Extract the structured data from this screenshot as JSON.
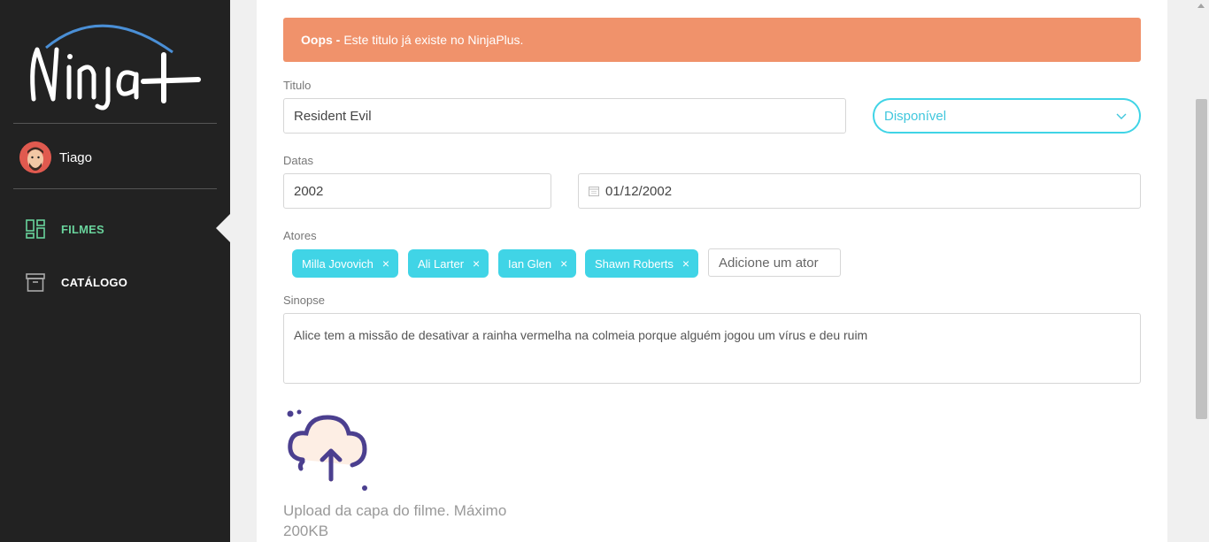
{
  "app": {
    "logo_text": "Ninja+"
  },
  "user": {
    "name": "Tiago"
  },
  "nav": {
    "items": [
      {
        "label": "FILMES",
        "icon": "dashboard-icon",
        "active": true
      },
      {
        "label": "CATÁLOGO",
        "icon": "archive-box-icon",
        "active": false
      }
    ]
  },
  "alert": {
    "strong": "Oops -",
    "message": "Este titulo já existe no NinjaPlus.",
    "color": "#f0926b"
  },
  "form": {
    "title_label": "Titulo",
    "title_value": "Resident Evil",
    "status_value": "Disponível",
    "dates_label": "Datas",
    "year_value": "2002",
    "release_date_value": "01/12/2002",
    "actors_label": "Atores",
    "actors": [
      "Milla Jovovich",
      "Ali Larter",
      "Ian Glen",
      "Shawn Roberts"
    ],
    "actor_placeholder": "Adicione um ator",
    "synopsis_label": "Sinopse",
    "synopsis_value": "Alice tem a missão de desativar a rainha vermelha na colmeia porque alguém jogou um vírus e deu ruim",
    "upload_text": "Upload da capa do filme. Máximo 200KB",
    "remove_glyph": "×"
  },
  "colors": {
    "accent": "#40d4e6",
    "active_nav": "#69d39c",
    "sidebar": "#222222"
  }
}
